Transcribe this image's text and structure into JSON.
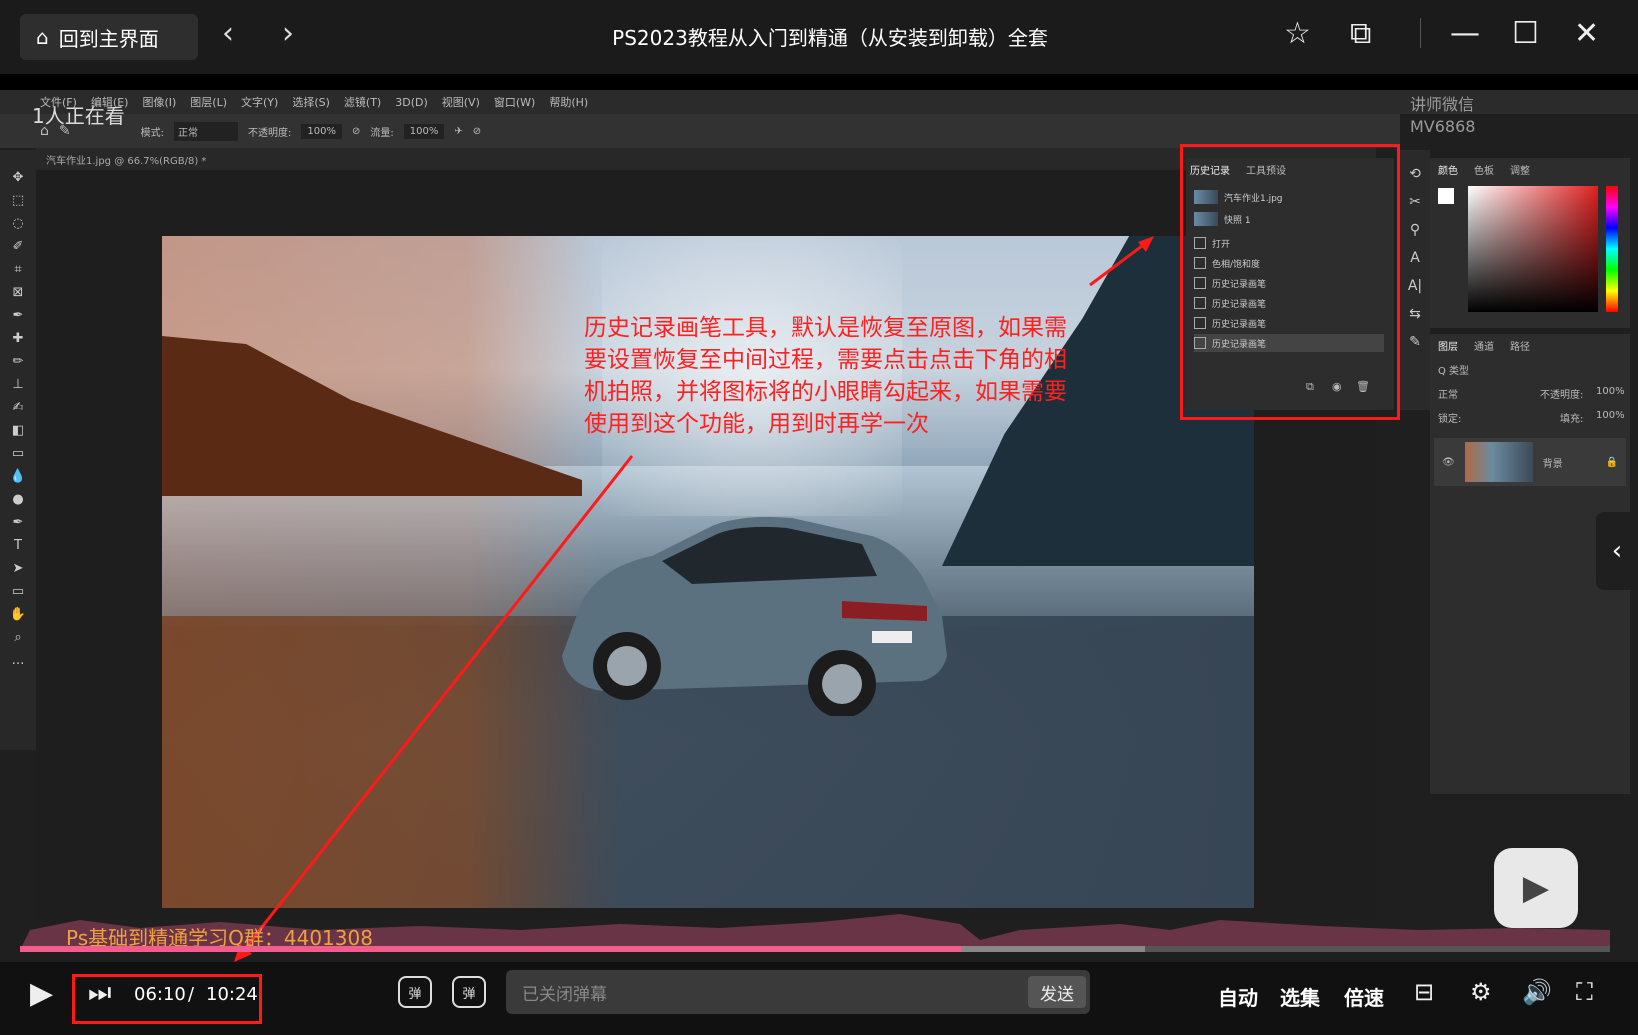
{
  "top_bar": {
    "home_label": "回到主界面",
    "home_icon": "house-icon",
    "back_icon": "chevron-left-icon",
    "forward_icon": "chevron-right-icon",
    "title": "PS2023教程从入门到精通（从安装到卸载）全套",
    "pin_icon": "pin-icon",
    "pip_icon": "picture-in-picture-icon",
    "minimize_icon": "minimize-icon",
    "maximize_icon": "maximize-icon",
    "close_icon": "close-icon"
  },
  "overlay": {
    "viewers": "1人正在看",
    "lecturer_line1": "讲师微信",
    "lecturer_line2": "MV6868",
    "qq_group": "Ps基础到精通学习Q群：4401308",
    "annotation": "历史记录画笔工具，默认是恢复至原图，如果需要设置恢复至中间过程，需要点击点击下角的相机拍照，并将图标将的小眼睛勾起来，如果需要使用到这个功能，用到时再学一次"
  },
  "photoshop": {
    "menu": [
      "文件(F)",
      "编辑(E)",
      "图像(I)",
      "图层(L)",
      "文字(Y)",
      "选择(S)",
      "滤镜(T)",
      "3D(D)",
      "视图(V)",
      "窗口(W)",
      "帮助(H)"
    ],
    "options": {
      "mode_label": "模式:",
      "mode_value": "正常",
      "opacity_label": "不透明度:",
      "opacity_value": "100%",
      "flow_label": "流量:",
      "flow_value": "100%"
    },
    "doc_tab": "汽车作业1.jpg @ 66.7%(RGB/8) *",
    "history_panel": {
      "tab_history": "历史记录",
      "tab_presets": "工具预设",
      "snapshots": [
        "汽车作业1.jpg",
        "快照 1"
      ],
      "steps": [
        "打开",
        "色相/饱和度",
        "历史记录画笔",
        "历史记录画笔",
        "历史记录画笔",
        "历史记录画笔"
      ]
    },
    "color_panel": {
      "tabs": [
        "颜色",
        "色板",
        "调整"
      ]
    },
    "layers_panel": {
      "tabs": [
        "图层",
        "通道",
        "路径"
      ],
      "kind_label": "Q 类型",
      "blend_mode": "正常",
      "opacity_label": "不透明度:",
      "opacity_value": "100%",
      "lock_label": "锁定:",
      "fill_label": "填充:",
      "fill_value": "100%",
      "layer_name": "背景"
    }
  },
  "player": {
    "progress": 0.592,
    "time_current": "06:10",
    "time_separator": "/",
    "time_total": "10:24",
    "danmaku_placeholder": "已关闭弹幕",
    "send_label": "发送",
    "auto_label": "自动",
    "episodes_label": "选集",
    "speed_label": "倍速"
  }
}
